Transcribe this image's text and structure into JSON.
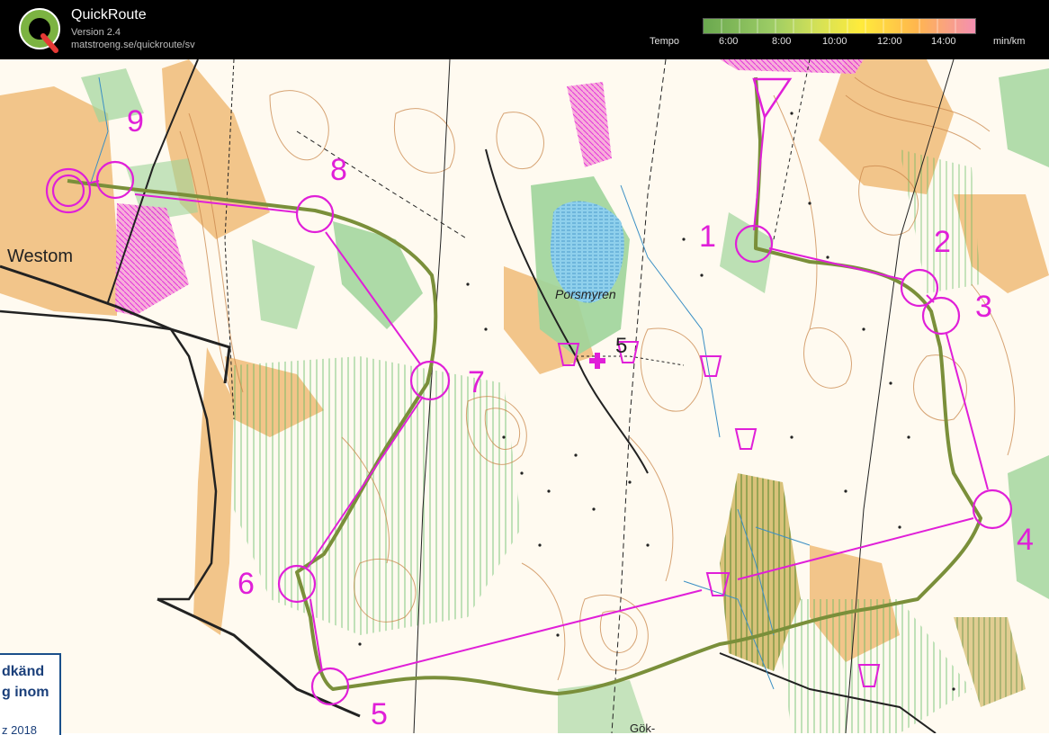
{
  "app": {
    "title": "QuickRoute",
    "version": "Version 2.4",
    "url": "matstroeng.se/quickroute/sv",
    "logo_letter": "Q"
  },
  "tempo_scale": {
    "label": "Tempo",
    "ticks": [
      "6:00",
      "8:00",
      "10:00",
      "12:00",
      "14:00"
    ],
    "unit": "min/km"
  },
  "map": {
    "places": {
      "westom": "Westom",
      "porsmyren": "Porsmyren",
      "gok": "Gök-"
    },
    "legend_lines": [
      "dkänd",
      "g inom",
      "z 2018"
    ],
    "controls": [
      {
        "number": "1"
      },
      {
        "number": "2"
      },
      {
        "number": "3"
      },
      {
        "number": "4"
      },
      {
        "number": "5"
      },
      {
        "number": "6"
      },
      {
        "number": "7"
      },
      {
        "number": "8"
      },
      {
        "number": "9"
      }
    ],
    "finish_number": "5",
    "colors": {
      "course": "#e01fd8",
      "route": "#7a8f3a",
      "contour": "#c9864a",
      "open_land": "#f2c58a",
      "water": "#7fc8e8",
      "vegetation": "#9fd49a",
      "header_bg": "#000000"
    }
  }
}
